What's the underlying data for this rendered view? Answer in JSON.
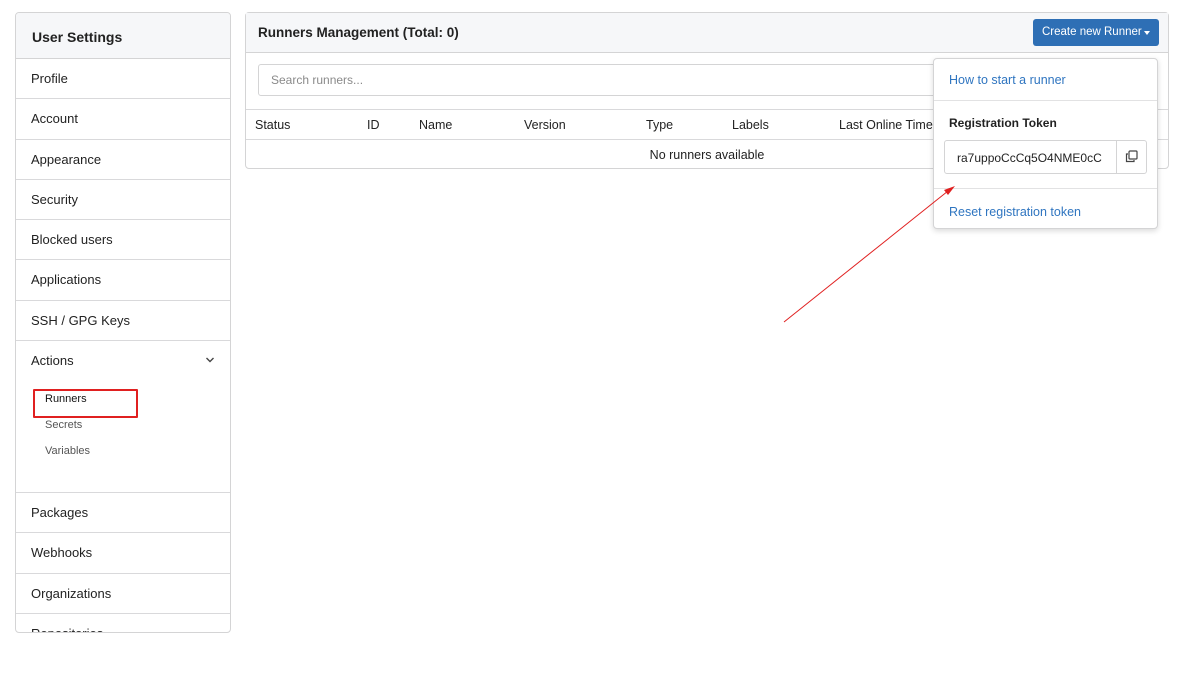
{
  "sidebar": {
    "title": "User Settings",
    "items": [
      {
        "label": "Profile"
      },
      {
        "label": "Account"
      },
      {
        "label": "Appearance"
      },
      {
        "label": "Security"
      },
      {
        "label": "Blocked users"
      },
      {
        "label": "Applications"
      },
      {
        "label": "SSH / GPG Keys"
      }
    ],
    "actions": {
      "label": "Actions",
      "expanded": true,
      "subitems": [
        {
          "label": "Runners",
          "active": true
        },
        {
          "label": "Secrets"
        },
        {
          "label": "Variables"
        }
      ]
    },
    "items_after": [
      {
        "label": "Packages"
      },
      {
        "label": "Webhooks"
      },
      {
        "label": "Organizations"
      },
      {
        "label": "Repositories"
      }
    ]
  },
  "main": {
    "title": "Runners Management (Total: 0)",
    "create_button": "Create new Runner",
    "search_placeholder": "Search runners...",
    "columns": [
      "Status",
      "ID",
      "Name",
      "Version",
      "Type",
      "Labels",
      "Last Online Time"
    ],
    "empty_text": "No runners available"
  },
  "dropdown": {
    "how_to_link": "How to start a runner",
    "token_label": "Registration Token",
    "token_value": "ra7uppoCcCq5O4NME0cC",
    "reset_link": "Reset registration token"
  },
  "colors": {
    "primary": "#2e6fb5",
    "link": "#2f75c0",
    "annotation": "#e02020"
  },
  "icons": {
    "copy": "copy-icon",
    "actions_toggle": "chevron-down-icon",
    "create_menu": "caret-down-icon"
  }
}
